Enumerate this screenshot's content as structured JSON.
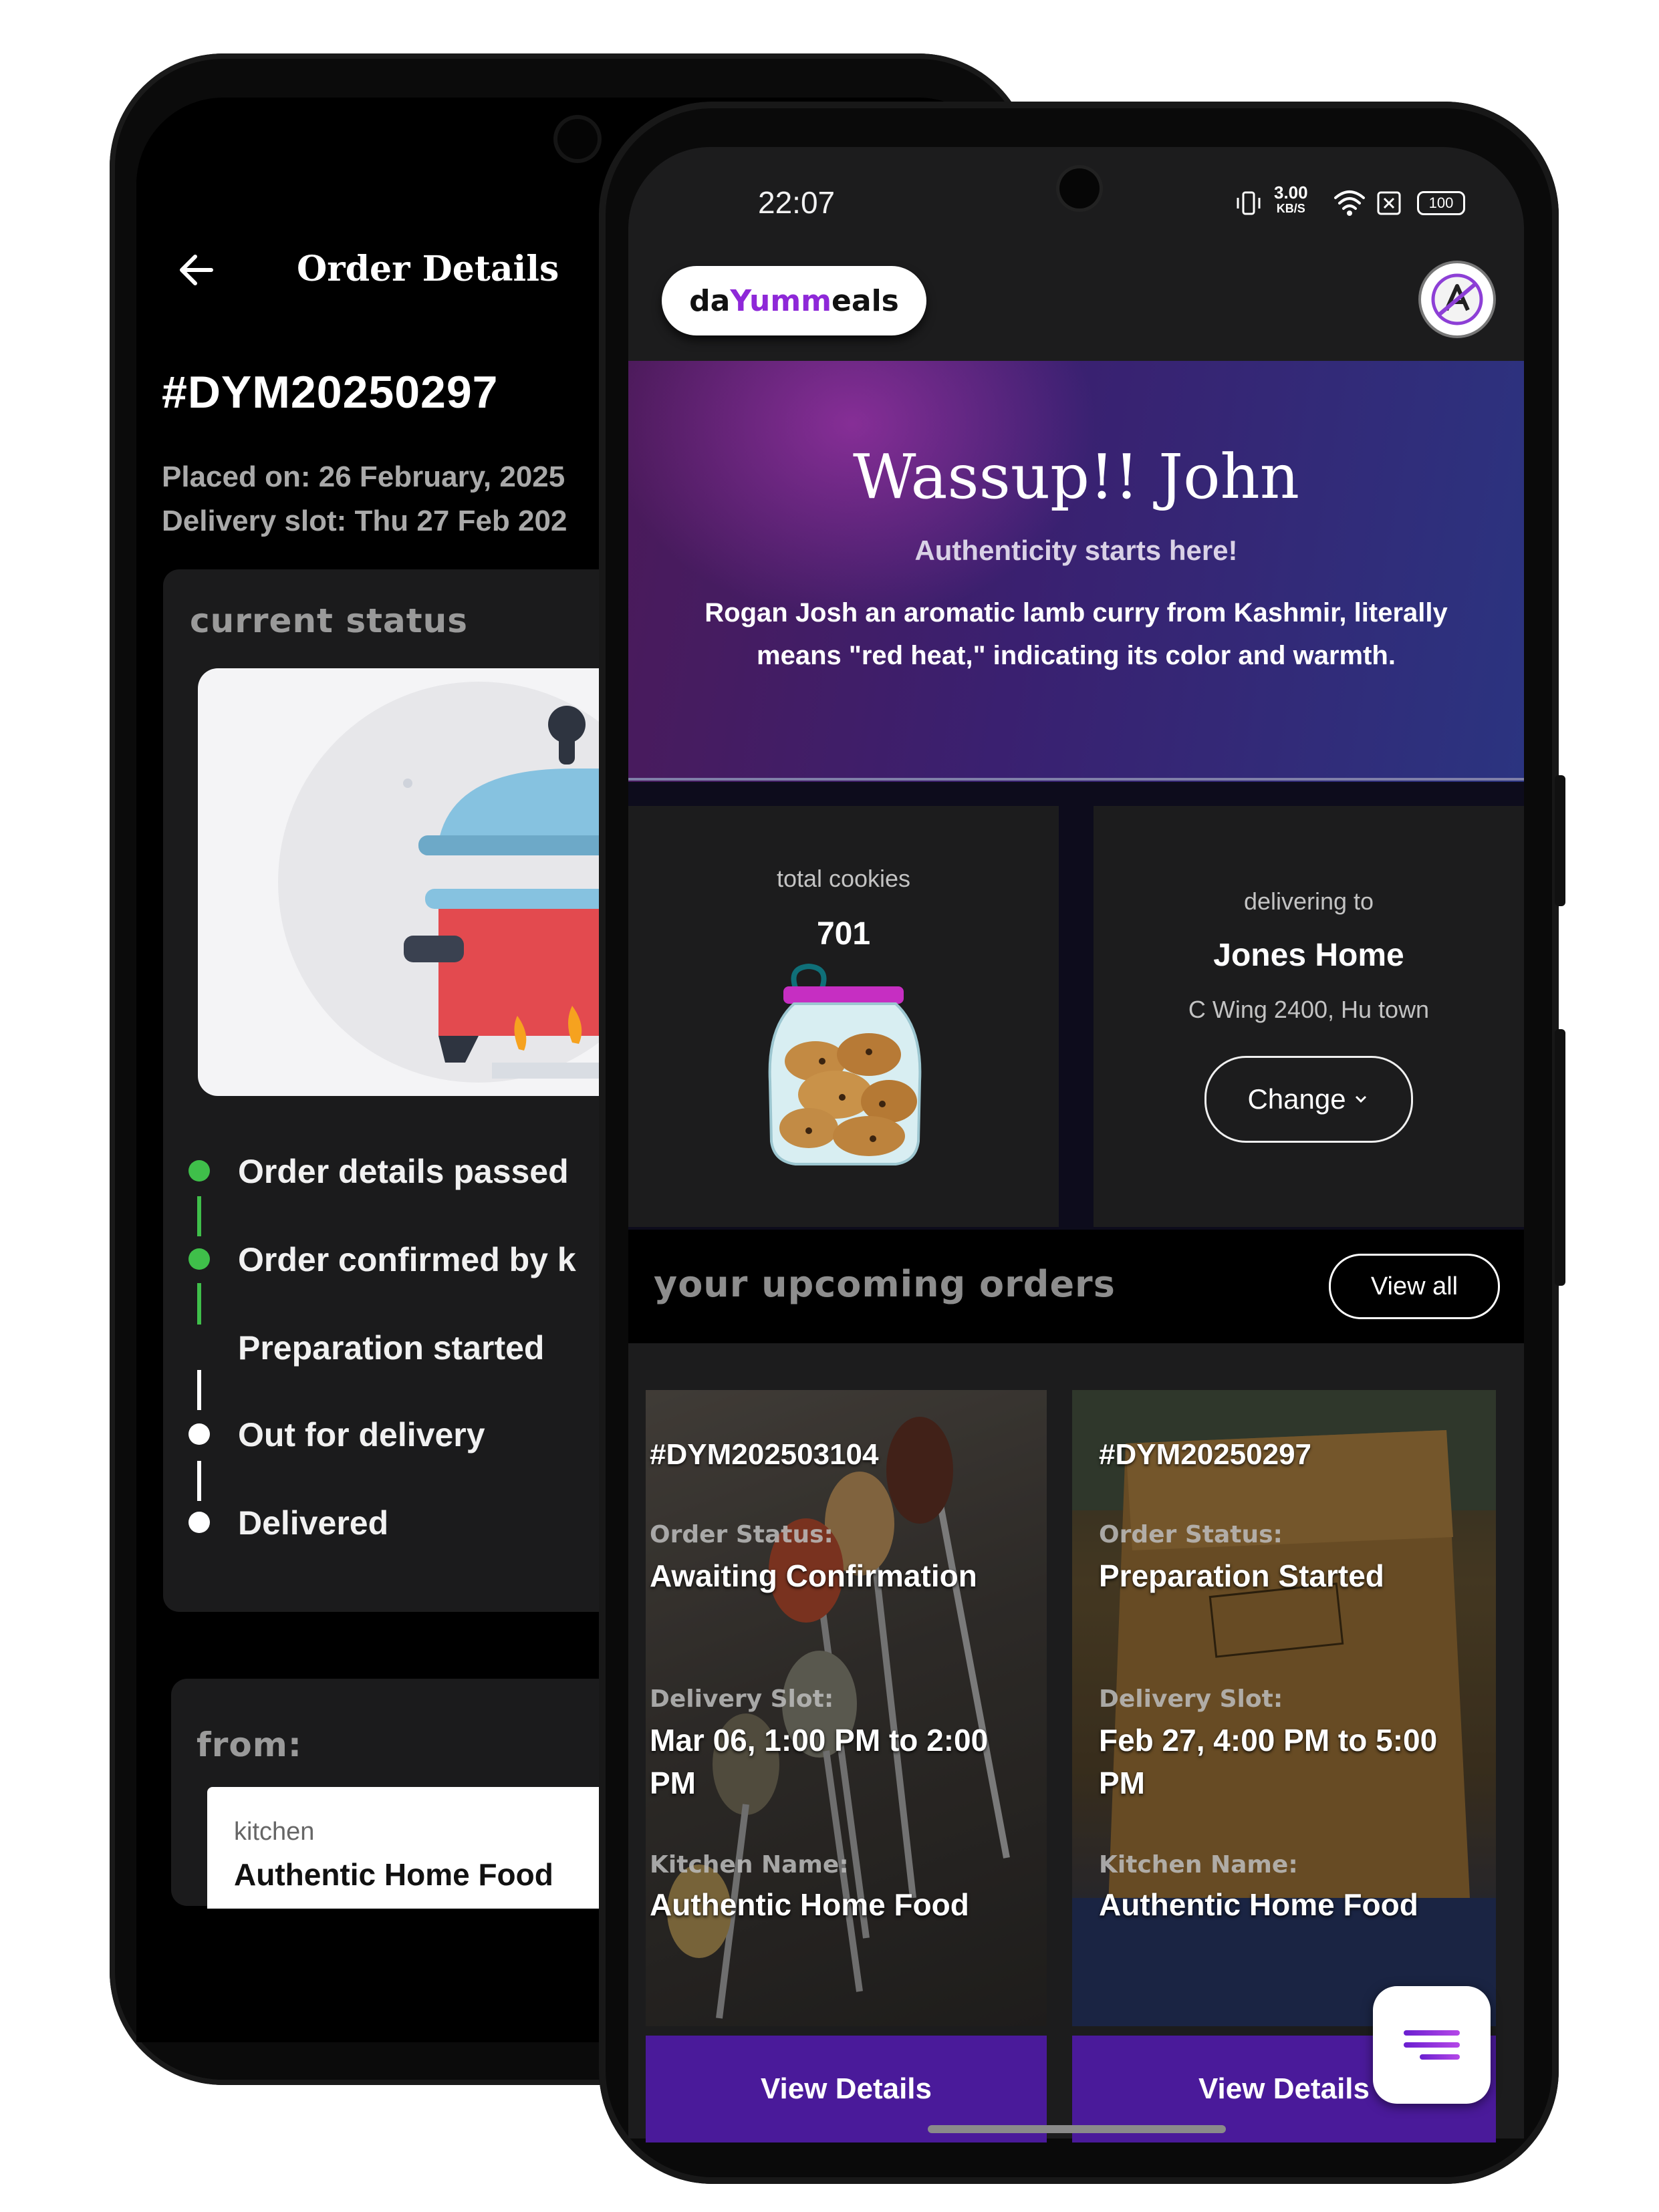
{
  "back_screen": {
    "title": "Order Details",
    "order_id": "#DYM20250297",
    "placed_on": "Placed on: 26 February, 2025",
    "delivery_slot": "Delivery slot: Thu 27 Feb 202",
    "status_heading": "current status",
    "steps": [
      {
        "label": "Order details passed",
        "state": "done"
      },
      {
        "label": "Order confirmed by k",
        "state": "done"
      },
      {
        "label": "Preparation started",
        "state": "current"
      },
      {
        "label": "Out for delivery",
        "state": "pending"
      },
      {
        "label": "Delivered",
        "state": "pending"
      }
    ],
    "from_heading": "from:",
    "kitchen_label": "kitchen",
    "kitchen_name": "Authentic Home Food"
  },
  "front_screen": {
    "status_bar": {
      "time": "22:07",
      "speed": "3.00",
      "speed_unit": "KB/S",
      "battery": "100"
    },
    "logo": {
      "part1": "da",
      "part2": "Yumm",
      "part3": "eals"
    },
    "hero": {
      "greeting": "Wassup!! John",
      "subtitle": "Authenticity starts here!",
      "line1": "Rogan Josh an aromatic lamb curry from Kashmir, literally",
      "line2": "means \"red heat,\" indicating its color and warmth."
    },
    "cookies": {
      "label": "total cookies",
      "value": "701"
    },
    "delivery": {
      "label": "delivering to",
      "name": "Jones Home",
      "address": "C Wing 2400, Hu town",
      "change_label": "Change"
    },
    "upcoming": {
      "title": "your upcoming orders",
      "view_all": "View all"
    },
    "orders": [
      {
        "id": "#DYM20250310​4",
        "status_label": "Order Status:",
        "status": "Awaiting Confirmation",
        "slot_label": "Delivery Slot:",
        "slot_line1": "Mar 06, 1:00 PM to 2:00",
        "slot_line2": "PM",
        "kitchen_label": "Kitchen Name:",
        "kitchen": "Authentic Home Food",
        "button": "View Details"
      },
      {
        "id": "#DYM20250297",
        "status_label": "Order Status:",
        "status": "Preparation Started",
        "slot_label": "Delivery Slot:",
        "slot_line1": "Feb 27, 4:00 PM to 5:00",
        "slot_line2": "PM",
        "kitchen_label": "Kitchen Name:",
        "kitchen": "Authentic Home Food",
        "button": "View Details"
      }
    ]
  },
  "colors": {
    "accent_purple": "#8e28d8",
    "button_purple": "#4a1a9a",
    "done_green": "#3fbf4a",
    "card_dark": "#1c1c1d"
  }
}
